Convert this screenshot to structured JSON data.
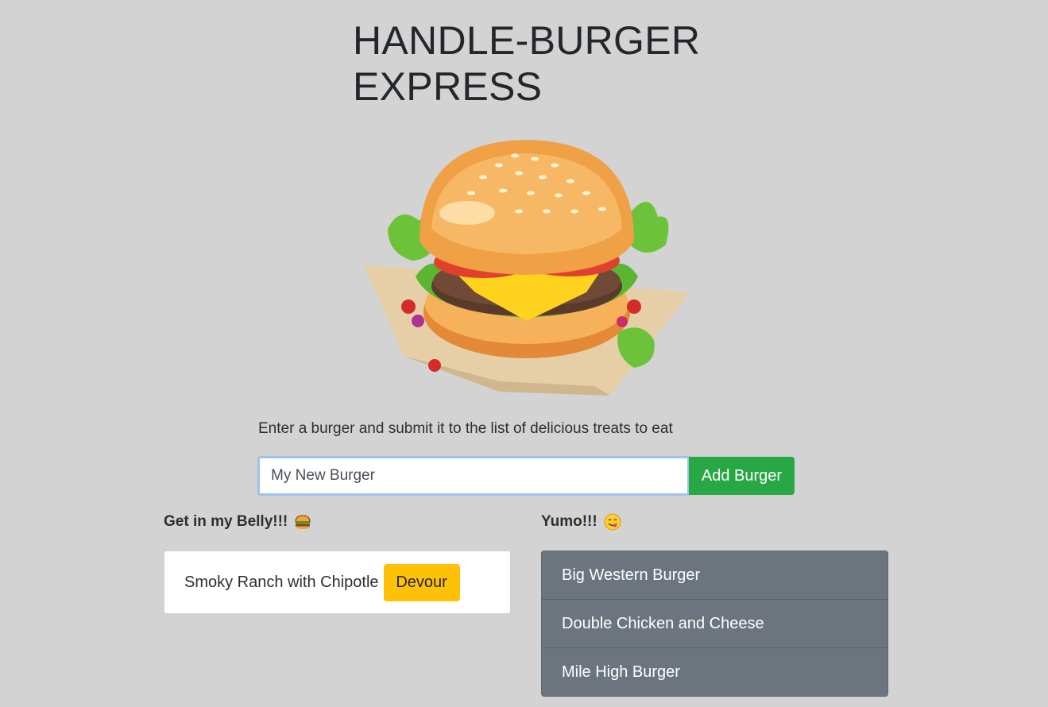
{
  "header": {
    "title_line1": "HANDLE-BURGER",
    "title_line2": "EXPRESS"
  },
  "hero": {
    "image": "burger-illustration"
  },
  "form": {
    "instructions": "Enter a burger and submit it to the list of delicious treats to eat",
    "input_value": "My New Burger",
    "submit_label": "Add Burger"
  },
  "belly": {
    "heading": "Get in my Belly!!!",
    "heading_icon": "hamburger-emoji-icon",
    "items": [
      {
        "name": "Smoky Ranch with Chipotle",
        "action_label": "Devour"
      }
    ]
  },
  "yumo": {
    "heading": "Yumo!!!",
    "heading_icon": "yum-face-emoji-icon",
    "items": [
      {
        "name": "Big Western Burger"
      },
      {
        "name": "Double Chicken and Cheese"
      },
      {
        "name": "Mile High Burger"
      }
    ]
  },
  "colors": {
    "background": "#d3d3d3",
    "add_button": "#28a745",
    "devour_button": "#ffc107",
    "devoured_list": "#6c757d"
  }
}
